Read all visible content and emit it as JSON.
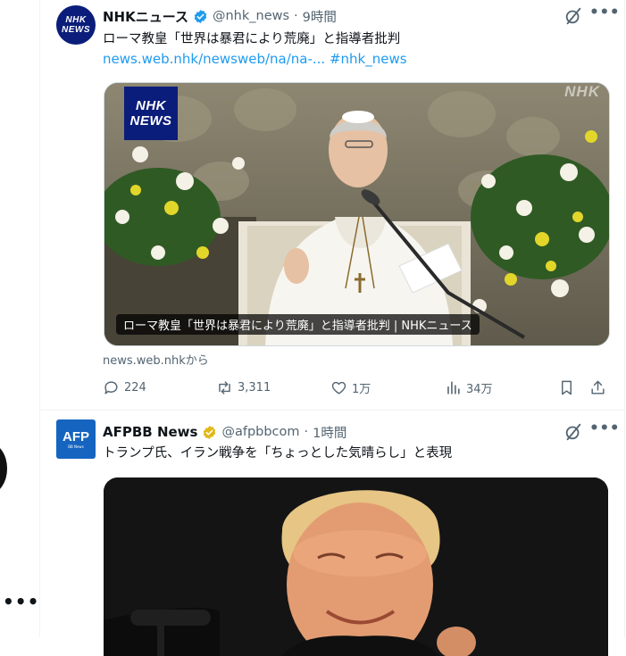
{
  "left_rail": {
    "more_icon": "more-horizontal-icon"
  },
  "tweets": [
    {
      "author_name": "NHKニュース",
      "avatar_text_top": "NHK",
      "avatar_text_bottom": "NEWS",
      "verified": "blue",
      "handle": "@nhk_news",
      "separator": "·",
      "time": "9時間",
      "text": "ローマ教皇「世界は暴君により荒廃」と指導者批判",
      "link": "news.web.nhk/newsweb/na/na-...",
      "hashtag": "#nhk_news",
      "media": {
        "logo_top": "NHK",
        "logo_bottom": "NEWS",
        "watermark": "NHK",
        "caption": "ローマ教皇「世界は暴君により荒廃」と指導者批判 | NHKニュース"
      },
      "source": "news.web.nhkから",
      "stats": {
        "replies": "224",
        "reposts": "3,311",
        "likes": "1万",
        "views": "34万"
      }
    },
    {
      "author_name": "AFPBB News",
      "avatar_text": "AFP",
      "avatar_sub": "BB News",
      "verified": "gold",
      "handle": "@afpbbcom",
      "separator": "·",
      "time": "1時間",
      "text": "トランプ氏、イラン戦争を「ちょっとした気晴らし」と表現"
    }
  ],
  "colors": {
    "accent": "#1d9bf0",
    "nhk_blue": "#0b1d7a",
    "afp_blue": "#1565c0",
    "gold": "#e2b719",
    "muted": "#536471"
  }
}
